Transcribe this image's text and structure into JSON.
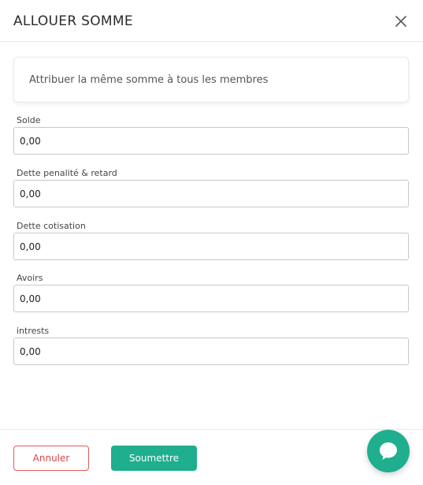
{
  "modal": {
    "title": "ALLOUER SOMME"
  },
  "toggle": {
    "label": "Attribuer la même somme à tous les membres"
  },
  "fields": [
    {
      "label": "Solde",
      "value": "0,00"
    },
    {
      "label": "Dette penalité & retard",
      "value": "0,00"
    },
    {
      "label": "Dette cotisation",
      "value": "0,00"
    },
    {
      "label": "Avoirs",
      "value": "0,00"
    },
    {
      "label": "intrests",
      "value": "0,00"
    }
  ],
  "footer": {
    "cancel_label": "Annuler",
    "submit_label": "Soumettre"
  },
  "icons": {
    "close": "close-icon",
    "chat": "chat-icon"
  },
  "colors": {
    "accent": "#1fae8e",
    "danger": "#e05a5a"
  }
}
